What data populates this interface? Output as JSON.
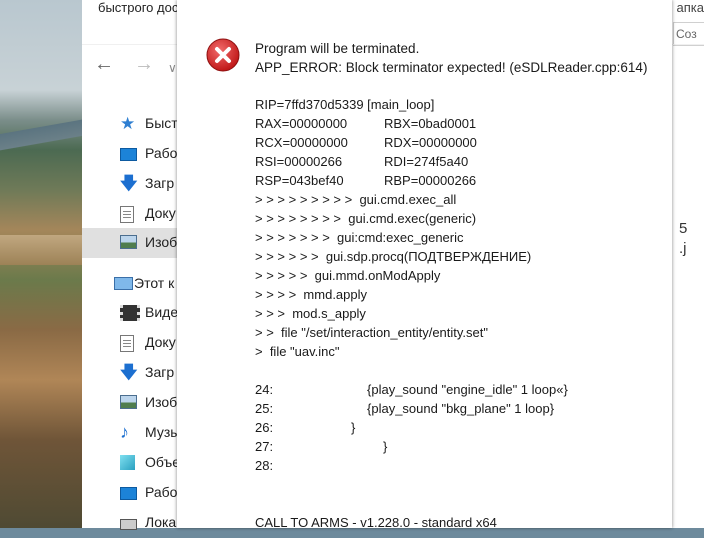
{
  "explorer": {
    "title_fragment": "быстрого дос",
    "title_right_fragment": "апка",
    "search_fragment": "Соз",
    "sidebar": [
      {
        "label": "Быстр",
        "icon": "star-icon"
      },
      {
        "label": "Рабо",
        "icon": "desktop-icon"
      },
      {
        "label": "Загр",
        "icon": "download-icon"
      },
      {
        "label": "Доку",
        "icon": "document-icon"
      },
      {
        "label": "Изоб",
        "icon": "image-icon"
      },
      {
        "label": "Этот к",
        "icon": "computer-icon"
      },
      {
        "label": "Виде",
        "icon": "video-icon"
      },
      {
        "label": "Доку",
        "icon": "document-icon"
      },
      {
        "label": "Загр",
        "icon": "download-icon"
      },
      {
        "label": "Изоб",
        "icon": "image-icon"
      },
      {
        "label": "Музы",
        "icon": "music-icon"
      },
      {
        "label": "Объе",
        "icon": "3d-objects-icon"
      },
      {
        "label": "Рабо",
        "icon": "desktop-icon"
      },
      {
        "label": "Лока",
        "icon": "drive-icon"
      }
    ],
    "right_fragments": [
      "5",
      ".j"
    ]
  },
  "dialog": {
    "header_line1": "Program will be terminated.",
    "header_line2": "APP_ERROR: Block terminator expected! (eSDLReader.cpp:614)",
    "rip": "RIP=7ffd370d5339 [main_loop]",
    "registers": [
      {
        "left": "RAX=00000000",
        "right": "RBX=0bad0001"
      },
      {
        "left": "RCX=00000000",
        "right": "RDX=00000000"
      },
      {
        "left": "RSI=00000266",
        "right": "RDI=274f5a40"
      },
      {
        "left": "RSP=043bef40",
        "right": "RBP=00000266"
      }
    ],
    "stack": [
      "> > > > > > > > >  gui.cmd.exec_all",
      "> > > > > > > >  gui.cmd.exec(generic)",
      "> > > > > > >  gui:cmd:exec_generic",
      "> > > > > >  gui.sdp.procq(ПОДТВЕРЖДЕНИЕ)",
      "> > > > >  gui.mmd.onModApply",
      "> > > >  mmd.apply",
      "> > >  mod.s_apply",
      "> >  file \"/set/interaction_entity/entity.set\"",
      ">  file \"uav.inc\""
    ],
    "code_lines": [
      {
        "num": "24:",
        "text": "{play_sound \"engine_idle\" 1 loop«}"
      },
      {
        "num": "25:",
        "text": "{play_sound \"bkg_plane\" 1 loop}"
      },
      {
        "num": "26:",
        "text": "}"
      },
      {
        "num": "27:",
        "text": "}"
      },
      {
        "num": "28:",
        "text": ""
      }
    ],
    "footer": "CALL TO ARMS - v1.228.0 - standard x64"
  },
  "colors": {
    "error_red": "#d32f2f",
    "selected_bg": "#e0e0e0",
    "accent_blue": "#1c83d8"
  }
}
